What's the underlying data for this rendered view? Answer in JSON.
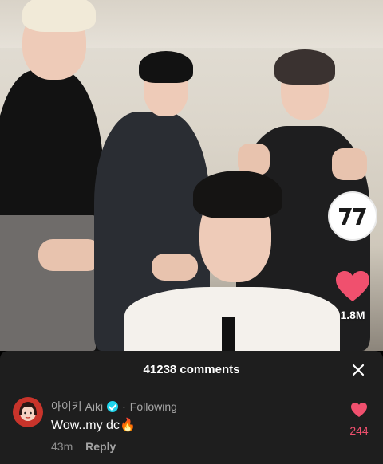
{
  "video": {
    "channel_logo": "seventeen-logo-icon",
    "like_count": "1.8M"
  },
  "comments_sheet": {
    "title": "41238 comments",
    "close_icon": "close-icon",
    "comment": {
      "username": "아이키 Aiki",
      "separator": "·",
      "follow_status": "Following",
      "text": "Wow..my dc🔥",
      "time": "43m",
      "reply_label": "Reply",
      "like_count": "244"
    }
  },
  "colors": {
    "like_red": "#f0506e",
    "sheet_bg": "#1e1e1e",
    "verified_blue": "#20d5ec"
  }
}
